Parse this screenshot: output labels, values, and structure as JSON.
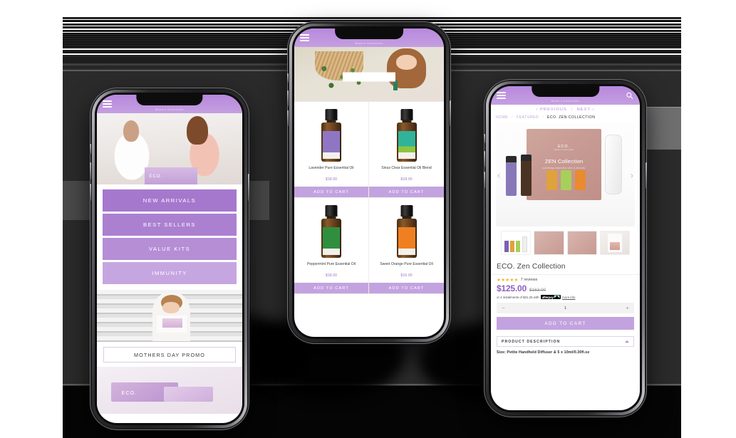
{
  "brand": {
    "name": "ECO.",
    "tagline": "Modern Essentials"
  },
  "colors": {
    "brand_purple": "#b888dd",
    "button_purple": "#c3a3df",
    "price_purple": "#8e5fc0",
    "backdrop_dark": "#2b2b2b",
    "star_gold": "#f0b429"
  },
  "phone1": {
    "name": "home-screen",
    "appbar": {
      "menu_icon": "hamburger-icon",
      "logo": "ECO.",
      "logo_sub": "Modern Essentials"
    },
    "hero_alt": "two women opening an ECO. gift box",
    "categories": [
      {
        "label": "NEW ARRIVALS",
        "color": "#a678cd"
      },
      {
        "label": "BEST SELLERS",
        "color": "#ab80d0"
      },
      {
        "label": "VALUE KITS",
        "color": "#b58ed6"
      },
      {
        "label": "IMMUNITY",
        "color": "#c6a6e0"
      }
    ],
    "promo_image_alt": "woman holding ECO. gift set",
    "promo_button": "MOTHERS DAY PROMO",
    "footer_image_alt": "ECO. boxed gift sets"
  },
  "phone2": {
    "name": "product-listing-screen",
    "appbar": {
      "menu_icon": "hamburger-icon",
      "logo": "ECO.",
      "logo_sub": "Modern Essentials"
    },
    "hero_alt": "woman smelling essential oil beside hanging plant",
    "search_value": "",
    "search_placeholder": "",
    "products": [
      {
        "name": "Lavender Pure Essential Oil",
        "price": "$18.00",
        "cta": "ADD TO CART",
        "label_color": "#8f76c4",
        "cap_color": "#151515"
      },
      {
        "name": "Sinus Clear Essential Oil Blend",
        "price": "$18.00",
        "cta": "ADD TO CART",
        "label_color": "#2fb39a",
        "cap_color": "#151515"
      },
      {
        "name": "Peppermint Pure Essential Oil",
        "price": "$18.00",
        "cta": "ADD TO CART",
        "label_color": "#2f8f3e",
        "cap_color": "#151515"
      },
      {
        "name": "Sweet Orange Pure Essential Oil",
        "price": "$16.00",
        "cta": "ADD TO CART",
        "label_color": "#ef8022",
        "cap_color": "#151515"
      }
    ]
  },
  "phone3": {
    "name": "product-detail-screen",
    "appbar": {
      "menu_icon": "hamburger-icon",
      "logo": "ECO.",
      "logo_sub": "Modern Essentials",
      "search_icon": "search-icon"
    },
    "pager": {
      "previous": "PREVIOUS",
      "next": "NEXT",
      "separator": "|"
    },
    "breadcrumb": {
      "home": "HOME",
      "category": "FEATURED",
      "current": "ECO. ZEN COLLECTION",
      "slash": "/"
    },
    "hero_box": {
      "logo": "ECO.",
      "logo_sub": "Modern essentials",
      "title": "ZEN Collection",
      "subtitle": "soothing essential oils & blends"
    },
    "gallery": {
      "prev_icon": "chevron-left-icon",
      "next_icon": "chevron-right-icon",
      "thumb_count": 4
    },
    "product_title": "ECO. Zen Collection",
    "rating": {
      "stars": "★★★★★",
      "stars_count": 5,
      "reviews": "7 reviews"
    },
    "price_current": "$125.00",
    "price_old": "$163.00",
    "afterpay": {
      "prefix": "or 4 instalments of $31.25 with",
      "logo": "afterpay",
      "more": "more info"
    },
    "quantity": {
      "minus": "−",
      "value": "1",
      "plus": "+"
    },
    "add_to_cart": "ADD TO CART",
    "accordion": {
      "label": "PRODUCT DESCRIPTION",
      "caret_icon": "caret-up-icon"
    },
    "size_line": "Size: Petite Handheld Diffuser & 5 x 10ml/0.30fl.oz"
  }
}
